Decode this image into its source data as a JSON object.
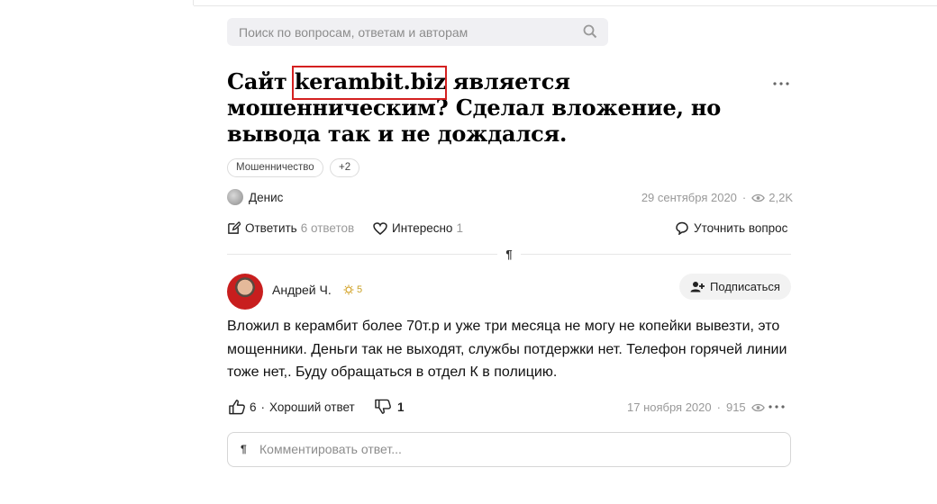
{
  "search": {
    "placeholder": "Поиск по вопросам, ответам и авторам"
  },
  "question": {
    "title_prefix": "Сайт ",
    "title_highlight": "kerambit.biz",
    "title_suffix": " является мошенническим? Сделал вложение, но вывода так и не дождался.",
    "tags": [
      "Мошенничество",
      "+2"
    ],
    "author": "Денис",
    "date": "29 сентября 2020",
    "views": "2,2K",
    "answer_label": "Ответить",
    "answers_count": "6 ответов",
    "interesting_label": "Интересно",
    "interesting_count": "1",
    "clarify_label": "Уточнить вопрос"
  },
  "answer": {
    "author": "Андрей Ч.",
    "rating": "5",
    "subscribe_label": "Подписаться",
    "text": "Вложил в керамбит более 70т.р и уже три месяца не могу не копейки вывезти, это мощенники. Деньги так не выходят, службы потдержки нет. Телефон горячей линии тоже нет,. Буду обращаться в отдел К в полицию.",
    "likes": "6",
    "good_answer_label": "Хороший ответ",
    "dislikes": "1",
    "date": "17 ноября 2020",
    "views": "915",
    "separator": "·"
  },
  "comment": {
    "placeholder": "Комментировать ответ..."
  },
  "colors": {
    "highlight_border": "#d42020",
    "muted": "#999999"
  },
  "icons": [
    "search-icon",
    "more-icon",
    "eye-icon",
    "edit-icon",
    "heart-icon",
    "chat-icon",
    "add-user-icon",
    "thumb-up-icon",
    "thumb-down-icon",
    "star-icon"
  ]
}
